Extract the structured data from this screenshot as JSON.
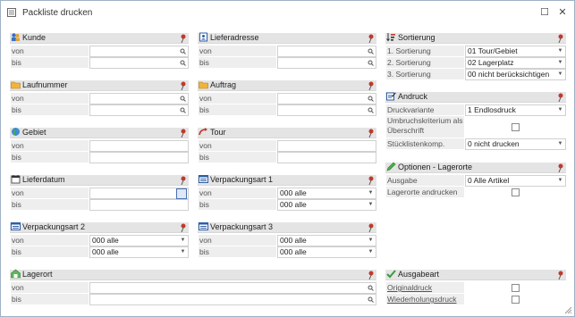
{
  "window": {
    "title": "Packliste drucken",
    "maximize_glyph": "☐",
    "close_glyph": "✕"
  },
  "labels": {
    "von": "von",
    "bis": "bis"
  },
  "groups": {
    "kunde": {
      "title": "Kunde"
    },
    "lieferadresse": {
      "title": "Lieferadresse"
    },
    "laufnummer": {
      "title": "Laufnummer"
    },
    "auftrag": {
      "title": "Auftrag"
    },
    "gebiet": {
      "title": "Gebiet"
    },
    "tour": {
      "title": "Tour"
    },
    "lieferdatum": {
      "title": "Lieferdatum"
    },
    "verpackungsart1": {
      "title": "Verpackungsart 1",
      "von_value": "000 alle",
      "bis_value": "000 alle"
    },
    "verpackungsart2": {
      "title": "Verpackungsart 2",
      "von_value": "000 alle",
      "bis_value": "000 alle"
    },
    "verpackungsart3": {
      "title": "Verpackungsart 3",
      "von_value": "000 alle",
      "bis_value": "000 alle"
    },
    "lagerort": {
      "title": "Lagerort"
    }
  },
  "sortierung": {
    "title": "Sortierung",
    "rows": [
      {
        "label": "1. Sortierung",
        "value": "01 Tour/Gebiet"
      },
      {
        "label": "2. Sortierung",
        "value": "02 Lagerplatz"
      },
      {
        "label": "3. Sortierung",
        "value": "00 nicht berücksichtigen"
      }
    ]
  },
  "andruck": {
    "title": "Andruck",
    "druckvariante_label": "Druckvariante",
    "druckvariante_value": "1 Endlosdruck",
    "umbruch_label": "Umbruchskriterium als Überschrift",
    "umbruch_checked": false,
    "stueckliste_label": "Stücklistenkomp.",
    "stueckliste_value": "0 nicht drucken"
  },
  "optionen": {
    "title": "Optionen - Lagerorte",
    "ausgabe_label": "Ausgabe",
    "ausgabe_value": "0 Alle Artikel",
    "lagerorte_label": "Lagerorte andrucken",
    "lagerorte_checked": false
  },
  "ausgabeart": {
    "title": "Ausgabeart",
    "originaldruck_label": "Originaldruck",
    "originaldruck_checked": false,
    "wiederholung_label": "Wiederholungsdruck",
    "wiederholung_checked": false
  },
  "icons": {
    "pin": "pin-icon",
    "search": "magnifier-icon",
    "dropdown": "chevron-down-icon",
    "calendar": "calendar-icon"
  },
  "colors": {
    "header_bg": "#e4e4e4",
    "label_bg": "#eeeeee",
    "accent": "#c0392b"
  }
}
